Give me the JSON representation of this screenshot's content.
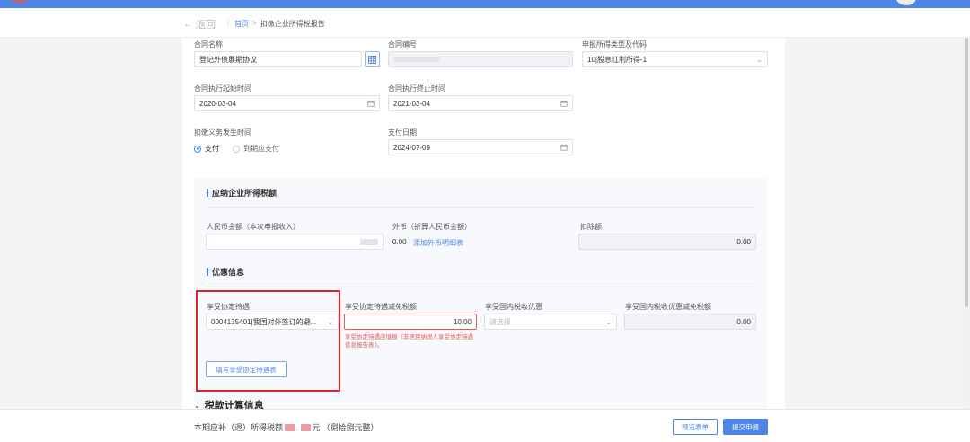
{
  "header": {
    "back_label": "返回",
    "breadcrumb": {
      "home": "首页",
      "separator": ">",
      "current": "扣缴企业所得税报告"
    }
  },
  "form": {
    "contract_name": {
      "label": "合同名称",
      "value": "登记外债展期协议"
    },
    "contract_no": {
      "label": "合同编号",
      "value": ""
    },
    "income_type": {
      "label": "申报所得类型及代码",
      "value": "10|股息红利所得-1"
    },
    "contract_start": {
      "label": "合同执行起始时间",
      "value": "2020-03-04"
    },
    "contract_end": {
      "label": "合同执行终止时间",
      "value": "2021-03-04"
    },
    "obligation_time": {
      "label": "扣缴义务发生时间",
      "option_paid": "支付",
      "option_due": "到期应支付",
      "selected": "支付"
    },
    "payment_date": {
      "label": "支付日期",
      "value": "2024-07-09"
    }
  },
  "tax_section": {
    "title": "应纳企业所得税额",
    "rmb": {
      "label": "人民币金额（本次申报收入）",
      "value": ""
    },
    "foreign": {
      "label": "外币（折算人民币金额）",
      "value": "0.00",
      "link": "添加外币明细表"
    },
    "deduction": {
      "label": "扣除额",
      "value": "0.00"
    }
  },
  "benefit_section": {
    "title": "优惠信息",
    "treaty": {
      "label": "享受协定待遇",
      "value": "0004135401|我国对外签订的避..."
    },
    "treaty_reduction": {
      "label": "享受协定待遇减免税额",
      "value": "10.00",
      "warning": "享受协定待遇应填报《非居民纳税人享受协定待遇信息报告表》。"
    },
    "domestic": {
      "label": "享受国内税收优惠",
      "placeholder": "请选择"
    },
    "domestic_reduction": {
      "label": "享受国内税收优惠减免税额",
      "value": "0.00"
    },
    "fill_button": "填写享受协定待遇表"
  },
  "calc_section": {
    "title": "税款计算信息"
  },
  "footer": {
    "prefix": "本期应补（退）所得税额",
    "suffix_unit": "元",
    "suffix_words": "（捌拾捌元整）",
    "preview_button": "预览表单",
    "submit_button": "提交申报"
  },
  "colors": {
    "primary": "#4e86e8",
    "error": "#e65a5a",
    "highlight_box": "#e5222c"
  }
}
